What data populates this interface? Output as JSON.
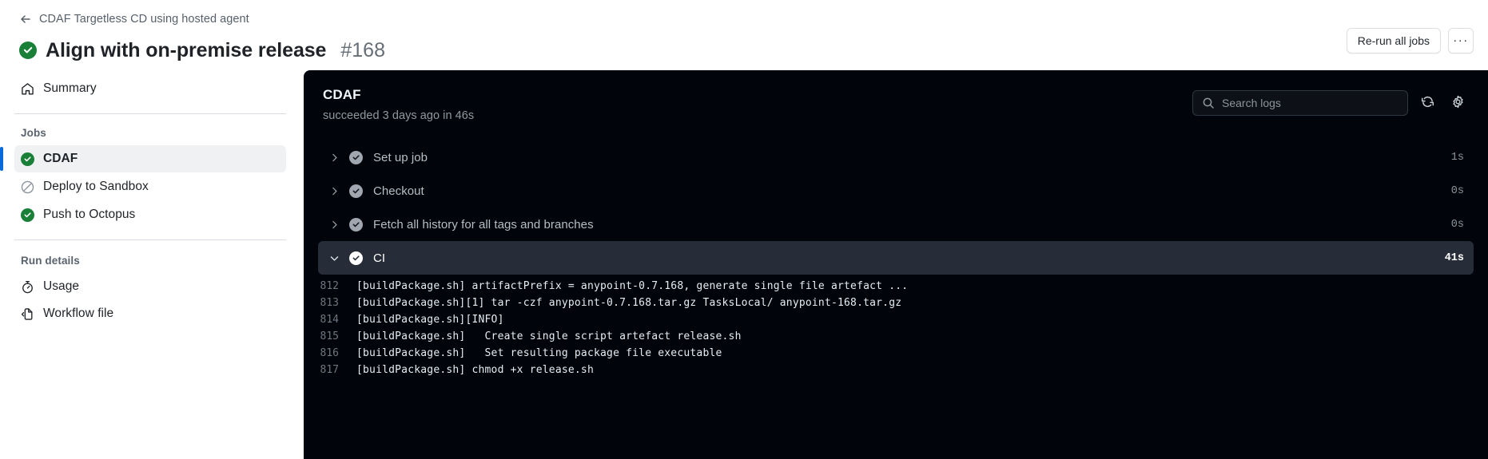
{
  "header": {
    "back_icon": "arrow-left-icon",
    "breadcrumb": "CDAF Targetless CD using hosted agent",
    "status_icon": "check-circle-fill-icon",
    "title": "Align with on-premise release",
    "run_number": "#168",
    "rerun_label": "Re-run all jobs",
    "kebab_label": "···"
  },
  "sidebar": {
    "summary": {
      "label": "Summary",
      "icon": "home-icon"
    },
    "jobs_label": "Jobs",
    "jobs": [
      {
        "label": "CDAF",
        "status": "success",
        "selected": true
      },
      {
        "label": "Deploy to Sandbox",
        "status": "skipped",
        "selected": false
      },
      {
        "label": "Push to Octopus",
        "status": "success",
        "selected": false
      }
    ],
    "run_details_label": "Run details",
    "run_details": [
      {
        "label": "Usage",
        "icon": "stopwatch-icon"
      },
      {
        "label": "Workflow file",
        "icon": "file-code-icon"
      }
    ]
  },
  "log_panel": {
    "job_title": "CDAF",
    "job_subtitle": "succeeded 3 days ago in 46s",
    "search": {
      "icon": "search-icon",
      "placeholder": "Search logs",
      "value": ""
    },
    "refresh_icon": "sync-icon",
    "settings_icon": "gear-icon",
    "steps": [
      {
        "name": "Set up job",
        "duration": "1s",
        "status": "success",
        "expanded": false,
        "chevron": "chevron-right-icon"
      },
      {
        "name": "Checkout",
        "duration": "0s",
        "status": "success",
        "expanded": false,
        "chevron": "chevron-right-icon"
      },
      {
        "name": "Fetch all history for all tags and branches",
        "duration": "0s",
        "status": "success",
        "expanded": false,
        "chevron": "chevron-right-icon"
      },
      {
        "name": "CI",
        "duration": "41s",
        "status": "success",
        "expanded": true,
        "chevron": "chevron-down-icon"
      }
    ],
    "log_lines": [
      {
        "num": "812",
        "text": "[buildPackage.sh] artifactPrefix = anypoint-0.7.168, generate single file artefact ..."
      },
      {
        "num": "813",
        "text": "[buildPackage.sh][1] tar -czf anypoint-0.7.168.tar.gz TasksLocal/ anypoint-168.tar.gz"
      },
      {
        "num": "814",
        "text": "[buildPackage.sh][INFO]"
      },
      {
        "num": "815",
        "text": "[buildPackage.sh]   Create single script artefact release.sh"
      },
      {
        "num": "816",
        "text": "[buildPackage.sh]   Set resulting package file executable"
      },
      {
        "num": "817",
        "text": "[buildPackage.sh] chmod +x release.sh"
      }
    ]
  },
  "colors": {
    "success_green": "#1a7f37",
    "accent_blue": "#0969da",
    "log_bg": "#01040a",
    "expanded_row_bg": "#272d38"
  }
}
